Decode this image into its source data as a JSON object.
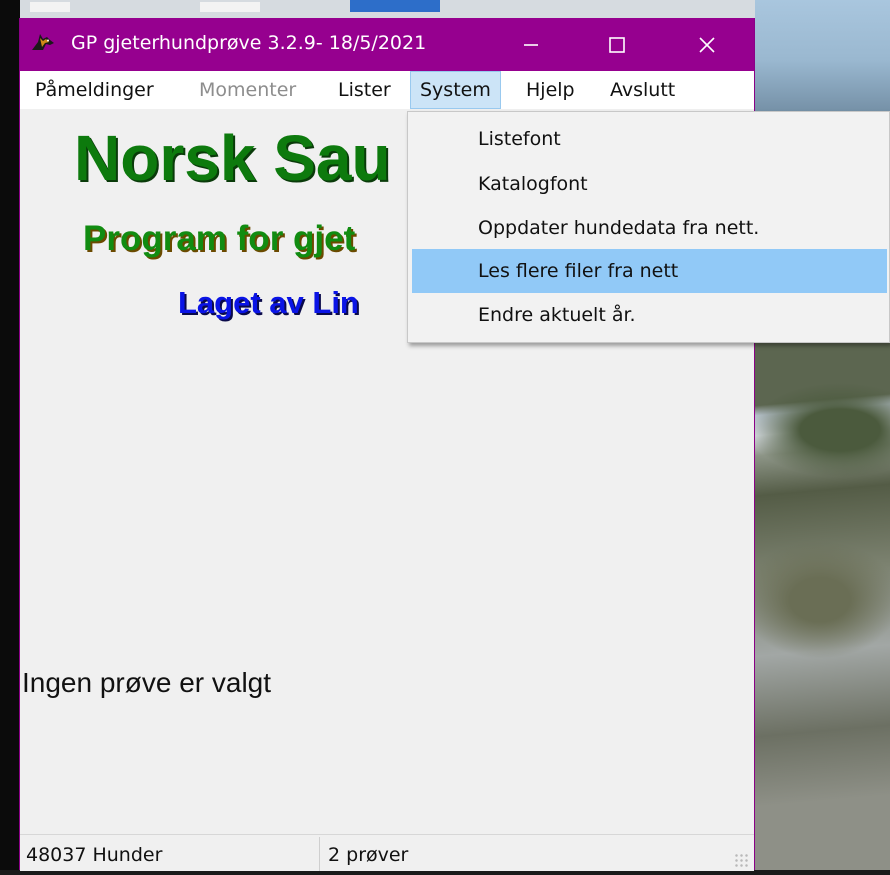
{
  "window": {
    "title": "GP gjeterhundprøve 3.2.9- 18/5/2021"
  },
  "menu": {
    "items": [
      {
        "label": "Påmeldinger",
        "enabled": true
      },
      {
        "label": "Momenter",
        "enabled": false
      },
      {
        "label": "Lister",
        "enabled": true
      },
      {
        "label": "System",
        "enabled": true,
        "active": true
      },
      {
        "label": "Hjelp",
        "enabled": true
      },
      {
        "label": "Avslutt",
        "enabled": true
      }
    ]
  },
  "system_menu": {
    "items": [
      {
        "label": "Listefont"
      },
      {
        "label": "Katalogfont"
      },
      {
        "label": "Oppdater hundedata fra nett."
      },
      {
        "label": "Les flere filer fra nett",
        "highlighted": true
      },
      {
        "label": "Endre aktuelt år."
      }
    ]
  },
  "content": {
    "title_visible": "Norsk Sau",
    "subtitle_visible": "Program for gjet",
    "author_visible": "Laget av Lin",
    "status_message": "Ingen prøve er valgt"
  },
  "statusbar": {
    "dogs": "48037 Hunder",
    "tests": "2 prøver"
  },
  "colors": {
    "titlebar": "#96008f",
    "title_green": "#0d7a0d",
    "author_blue": "#0a14e6",
    "menu_active": "#cce4f7",
    "dropdown_highlight": "#91c9f7"
  },
  "icons": {
    "app": "sheepdog-icon",
    "minimize": "minimize-icon",
    "maximize": "maximize-icon",
    "close": "close-icon"
  }
}
